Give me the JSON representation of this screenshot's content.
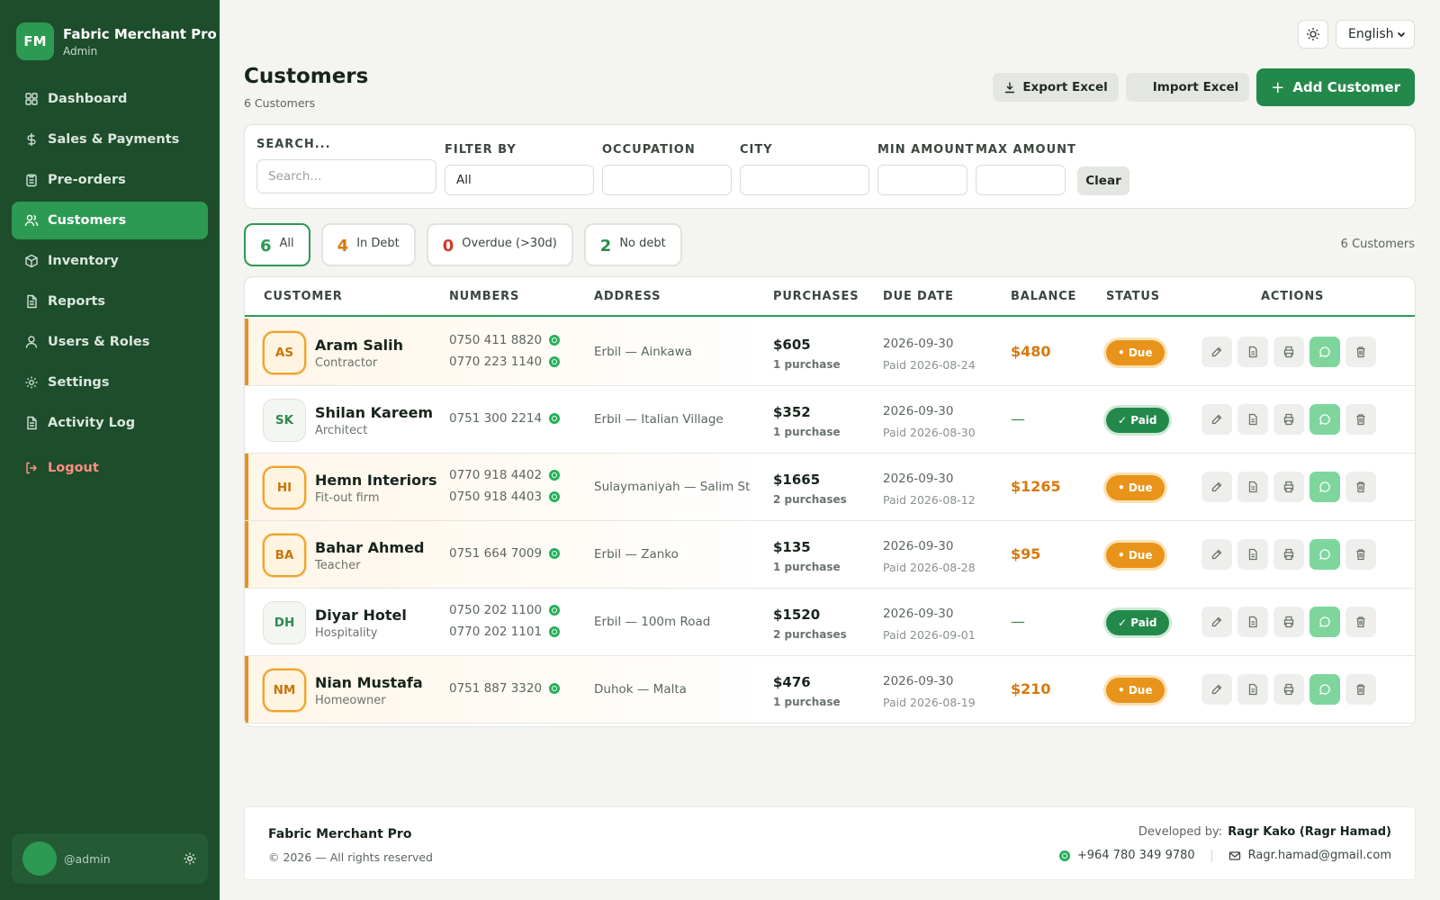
{
  "sidebar": {
    "logo": "FM",
    "app_name": "Fabric Merchant Pro",
    "role": "Admin",
    "items": [
      {
        "label": "Dashboard",
        "icon": "grid-icon"
      },
      {
        "label": "Sales & Payments",
        "icon": "dollar-icon"
      },
      {
        "label": "Pre-orders",
        "icon": "clipboard-icon"
      },
      {
        "label": "Customers",
        "icon": "users-icon",
        "active": true
      },
      {
        "label": "Inventory",
        "icon": "box-icon"
      },
      {
        "label": "Reports",
        "icon": "file-icon"
      },
      {
        "label": "Users & Roles",
        "icon": "user-icon"
      },
      {
        "label": "Settings",
        "icon": "gear-icon"
      },
      {
        "label": "Activity Log",
        "icon": "file-icon"
      }
    ],
    "logout": "Logout",
    "user_handle": "@admin"
  },
  "topbar": {
    "language": "English"
  },
  "page": {
    "title": "Customers",
    "subtitle": "6 Customers"
  },
  "toolbar": {
    "export": "Export Excel",
    "import": "Import Excel",
    "add": "Add Customer"
  },
  "filters": {
    "search_label": "SEARCH...",
    "search_placeholder": "Search...",
    "filter_by_label": "FILTER BY",
    "filter_by_value": "All",
    "occupation_label": "OCCUPATION",
    "city_label": "CITY",
    "min_label": "MIN AMOUNT",
    "max_label": "MAX AMOUNT",
    "clear": "Clear"
  },
  "chips": [
    {
      "count": "6",
      "label": "All",
      "color": "#2c9a52"
    },
    {
      "count": "4",
      "label": "In Debt",
      "color": "#d9780e"
    },
    {
      "count": "0",
      "label": "Overdue (>30d)",
      "color": "#d33a2c"
    },
    {
      "count": "2",
      "label": "No debt",
      "color": "#2c8a4d"
    }
  ],
  "chips_count": "6 Customers",
  "table": {
    "headers": [
      "CUSTOMER",
      "NUMBERS",
      "ADDRESS",
      "PURCHASES",
      "DUE DATE",
      "BALANCE",
      "STATUS",
      "ACTIONS"
    ],
    "rows": [
      {
        "initials": "AS",
        "name": "Aram Salih",
        "occupation": "Contractor",
        "phones": [
          "0750 411 8820",
          "0770 223 1140"
        ],
        "address": "Erbil — Ainkawa",
        "amount": "$605",
        "count": "1 purchase",
        "due": "2026-09-30",
        "paid": "Paid 2026-08-24",
        "balance": "$480",
        "status": "• Due",
        "debt": true
      },
      {
        "initials": "SK",
        "name": "Shilan Kareem",
        "occupation": "Architect",
        "phones": [
          "0751 300 2214"
        ],
        "address": "Erbil — Italian Village",
        "amount": "$352",
        "count": "1 purchase",
        "due": "2026-09-30",
        "paid": "Paid 2026-08-30",
        "balance": "—",
        "status": "✓ Paid",
        "debt": false
      },
      {
        "initials": "HI",
        "name": "Hemn Interiors",
        "occupation": "Fit-out firm",
        "phones": [
          "0770 918 4402",
          "0750 918 4403"
        ],
        "address": "Sulaymaniyah — Salim St",
        "amount": "$1665",
        "count": "2 purchases",
        "due": "2026-09-30",
        "paid": "Paid 2026-08-12",
        "balance": "$1265",
        "status": "• Due",
        "debt": true
      },
      {
        "initials": "BA",
        "name": "Bahar Ahmed",
        "occupation": "Teacher",
        "phones": [
          "0751 664 7009"
        ],
        "address": "Erbil — Zanko",
        "amount": "$135",
        "count": "1 purchase",
        "due": "2026-09-30",
        "paid": "Paid 2026-08-28",
        "balance": "$95",
        "status": "• Due",
        "debt": true
      },
      {
        "initials": "DH",
        "name": "Diyar Hotel",
        "occupation": "Hospitality",
        "phones": [
          "0750 202 1100",
          "0770 202 1101"
        ],
        "address": "Erbil — 100m Road",
        "amount": "$1520",
        "count": "2 purchases",
        "due": "2026-09-30",
        "paid": "Paid 2026-09-01",
        "balance": "—",
        "status": "✓ Paid",
        "debt": false
      },
      {
        "initials": "NM",
        "name": "Nian Mustafa",
        "occupation": "Homeowner",
        "phones": [
          "0751 887 3320"
        ],
        "address": "Duhok — Malta",
        "amount": "$476",
        "count": "1 purchase",
        "due": "2026-09-30",
        "paid": "Paid 2026-08-19",
        "balance": "$210",
        "status": "• Due",
        "debt": true
      }
    ]
  },
  "footer": {
    "app_name": "Fabric Merchant Pro",
    "copyright": "© 2026 — All rights reserved",
    "dev_label": "Developed by:",
    "dev_name": "Ragr Kako (Ragr Hamad)",
    "phone": "+964 780 349 9780",
    "email": "Ragr.hamad@gmail.com"
  },
  "colors": {
    "sidebar": "#1d4d2b",
    "accent": "#2c9a52",
    "due": "#e8941a",
    "paid": "#23894a"
  }
}
